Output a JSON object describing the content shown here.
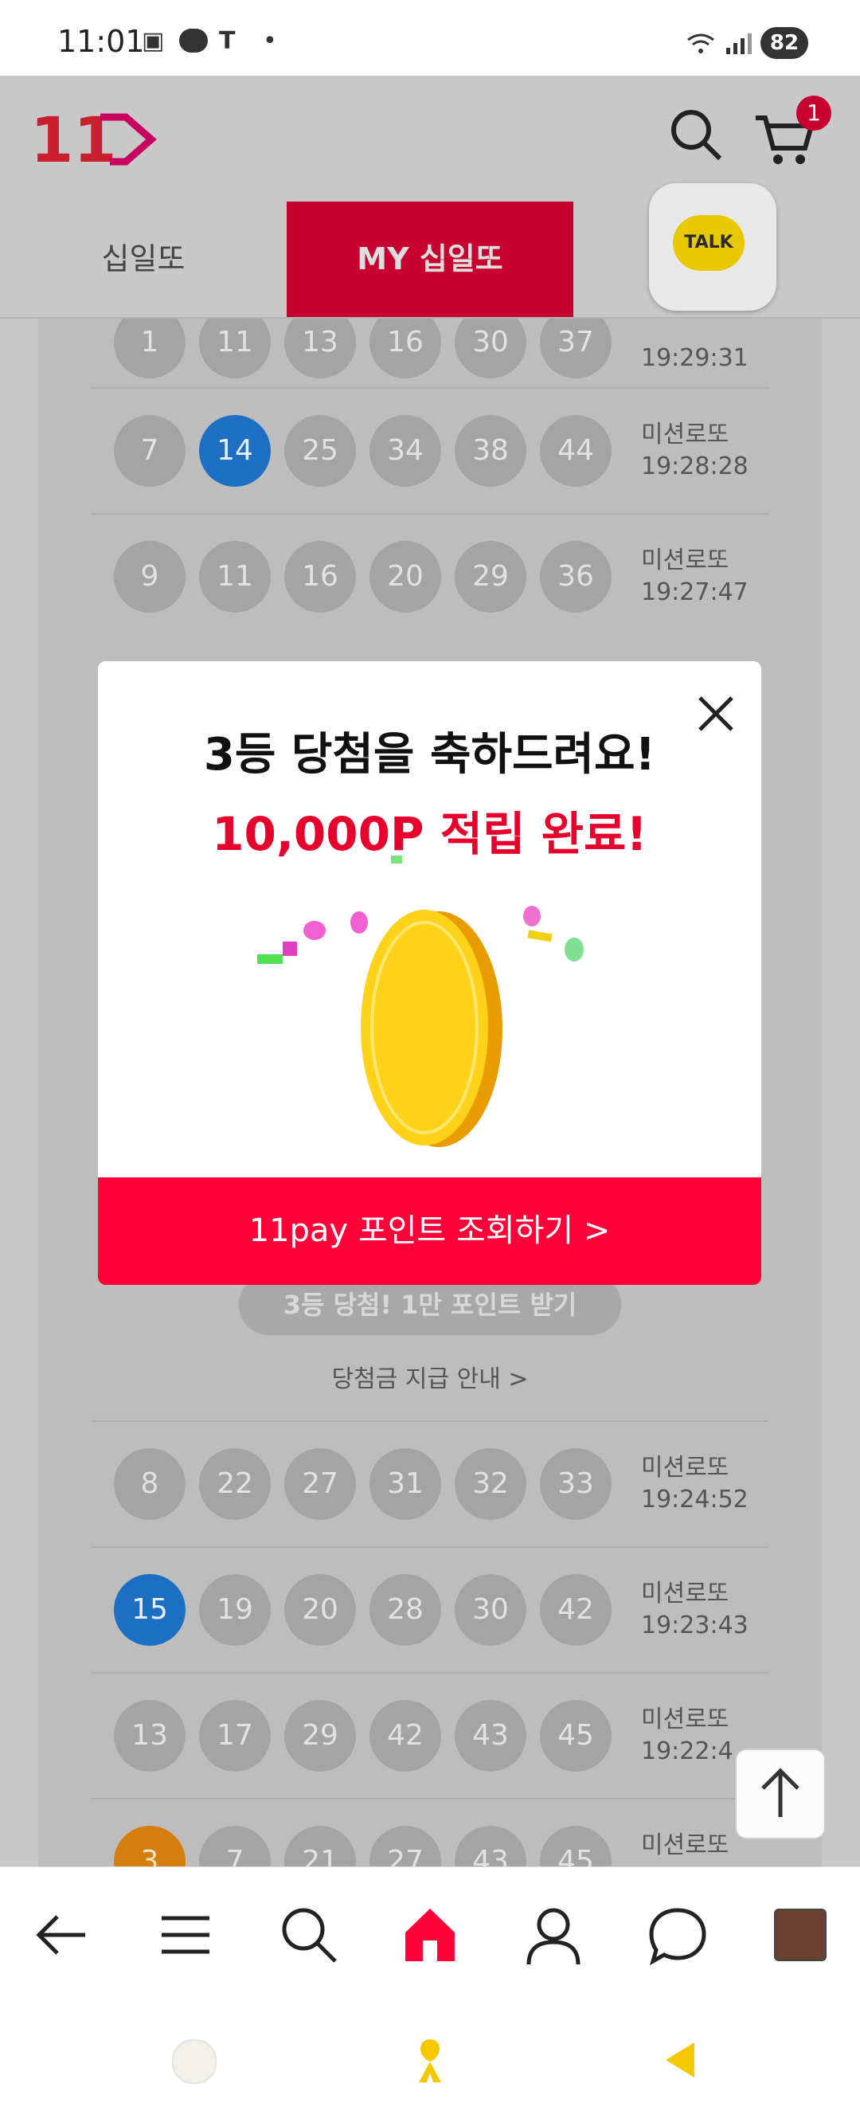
{
  "status_bar": {
    "time": "11:01",
    "battery": "82",
    "left_icons": [
      "screenshot-icon",
      "talk-icon",
      "t-icon",
      "dot-icon"
    ],
    "right_icons": [
      "wifi-icon",
      "signal-icon"
    ]
  },
  "header": {
    "logo": "11",
    "cart_count": "1"
  },
  "tabs": [
    {
      "label": "십일또"
    },
    {
      "label": "MY 십일또"
    }
  ],
  "kakao": {
    "label": "TALK"
  },
  "rows": [
    {
      "balls": [
        "1",
        "11",
        "13",
        "16",
        "30",
        "37"
      ],
      "highlight": [],
      "type": "",
      "time": "19:29:31"
    },
    {
      "balls": [
        "7",
        "14",
        "25",
        "34",
        "38",
        "44"
      ],
      "highlight": [
        1
      ],
      "type": "미션로또",
      "time": "19:28:28"
    },
    {
      "balls": [
        "9",
        "11",
        "16",
        "20",
        "29",
        "36"
      ],
      "highlight": [],
      "type": "미션로또",
      "time": "19:27:47"
    },
    {
      "balls": [
        "8",
        "22",
        "27",
        "31",
        "32",
        "33"
      ],
      "highlight": [],
      "type": "미션로또",
      "time": "19:24:52"
    },
    {
      "balls": [
        "15",
        "19",
        "20",
        "28",
        "30",
        "42"
      ],
      "highlight": [
        0
      ],
      "type": "미션로또",
      "time": "19:23:43"
    },
    {
      "balls": [
        "13",
        "17",
        "29",
        "42",
        "43",
        "45"
      ],
      "highlight": [],
      "type": "미션로또",
      "time": "19:22:4"
    },
    {
      "balls": [
        "3",
        "7",
        "21",
        "27",
        "43",
        "45"
      ],
      "highlight": [
        0
      ],
      "type": "미션로또",
      "time": ""
    }
  ],
  "claim_button": "3등 당첨! 1만 포인트 받기",
  "prize_info": "당첨금 지급 안내 >",
  "modal": {
    "title": "3등 당첨을 축하드려요!",
    "points": "10,000P 적립 완료!",
    "button": "11pay 포인트 조회하기 >"
  },
  "colors": {
    "brand_red": "#ff0038",
    "ball_blue": "#1d6fc4",
    "ball_orange": "#d47e10"
  },
  "nav": [
    "back-icon",
    "menu-icon",
    "search-icon",
    "home-icon",
    "profile-icon",
    "chat-icon",
    "thumbnail"
  ]
}
